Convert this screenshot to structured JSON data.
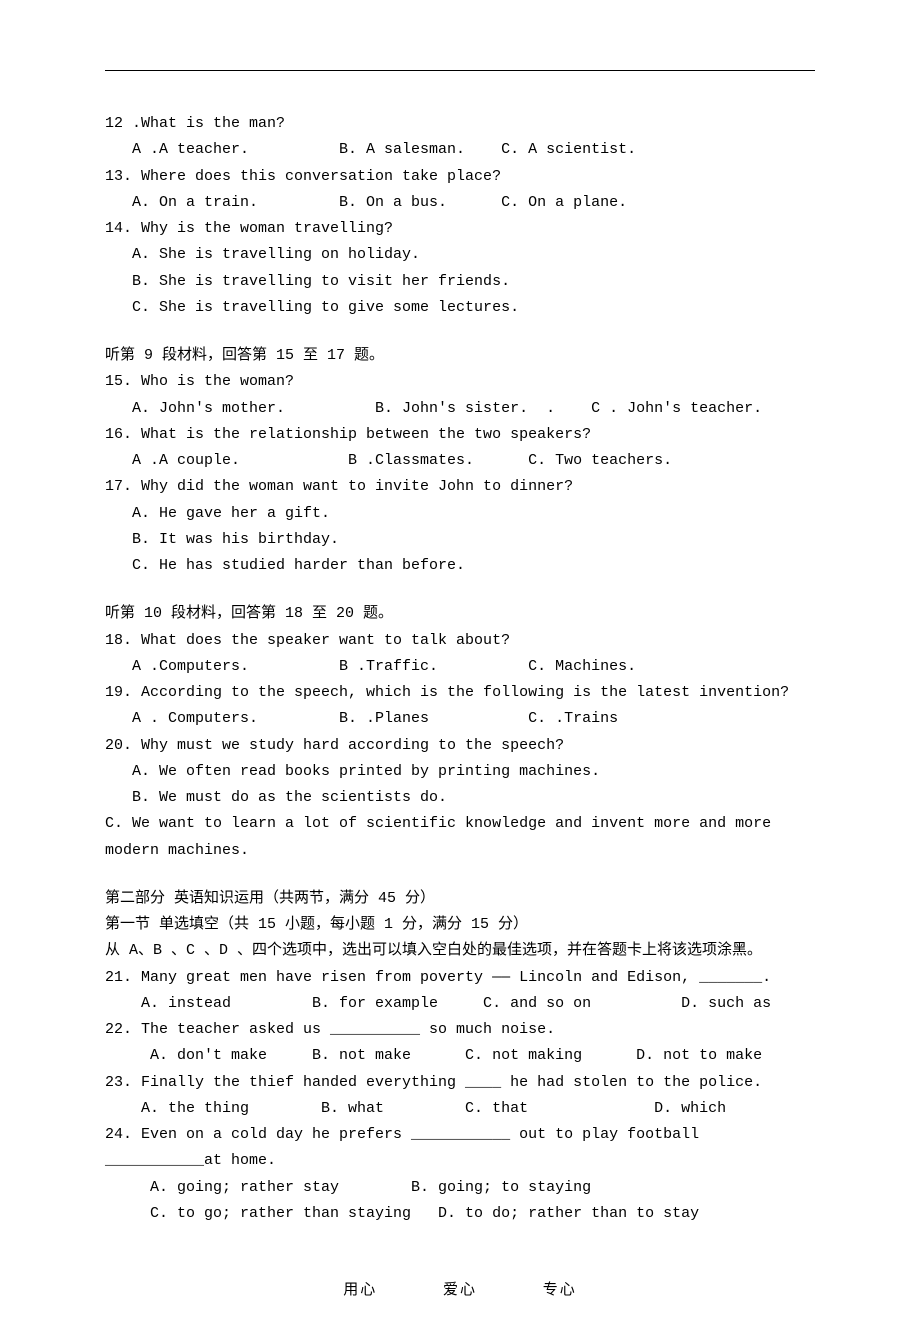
{
  "block1": {
    "q12": "12 .What is the man?",
    "q12_opts": "   A .A teacher.          B. A salesman.    C. A scientist.",
    "q13": "13. Where does this conversation take place?",
    "q13_opts": "   A. On a train.         B. On a bus.      C. On a plane.",
    "q14": "14. Why is the woman travelling?",
    "q14_a": "   A. She is travelling on holiday.",
    "q14_b": "   B. She is travelling to visit her friends.",
    "q14_c": "   C. She is travelling to give some lectures."
  },
  "block2": {
    "head": "听第 9 段材料，回答第 15 至 17 题。",
    "q15": "15. Who is the woman?",
    "q15_opts": "   A. John's mother.          B. John's sister.  .    C . John's teacher.",
    "q16": "16. What is the relationship between the two speakers?",
    "q16_opts": "   A .A couple.            B .Classmates.      C. Two teachers.",
    "q17": "17. Why did the woman want to invite John to dinner?",
    "q17_a": "   A. He gave her a gift.",
    "q17_b": "   B. It was his birthday.",
    "q17_c": "   C. He has studied harder than before."
  },
  "block3": {
    "head": "听第 10 段材料，回答第 18 至 20 题。",
    "q18": "18. What does the speaker want to talk about?",
    "q18_opts": "   A .Computers.          B .Traffic.          C. Machines.",
    "q19": "19. According to the speech, which is the following is the latest invention?",
    "q19_opts": "   A . Computers.         B. .Planes           C. .Trains",
    "q20": "20. Why must we study hard according to the speech?",
    "q20_a": "   A. We often read books printed by printing machines.",
    "q20_b": "   B. We must do as the scientists do.",
    "q20_c": "   C. We want to learn a lot of scientific knowledge and invent more and more modern machines."
  },
  "part2": {
    "head1": "第二部分  英语知识运用（共两节，满分 45 分）",
    "head2": "第一节     单选填空（共 15  小题，每小题 1 分，满分 15 分）",
    "instr": "    从 A、B 、C 、D 、四个选项中，选出可以填入空白处的最佳选项，并在答题卡上将该选项涂黑。",
    "q21": "21. Many great men have risen from poverty —— Lincoln and Edison, _______.",
    "q21_opts": "    A. instead         B. for example     C. and so on          D. such as",
    "q22": "22. The teacher asked us __________ so much noise.",
    "q22_opts": "     A. don't make     B. not make      C. not making      D. not to make",
    "q23": "23. Finally the thief handed everything ____ he had stolen to the police.",
    "q23_opts": "    A. the thing        B. what         C. that              D. which",
    "q24": "24. Even on a cold day he prefers ___________ out to play football ___________at home.",
    "q24_ab": "     A. going; rather stay        B. going; to staying",
    "q24_cd": "     C. to go; rather than staying   D. to do; rather than to stay"
  },
  "footer": {
    "a": "用心",
    "b": "爱心",
    "c": "专心"
  }
}
